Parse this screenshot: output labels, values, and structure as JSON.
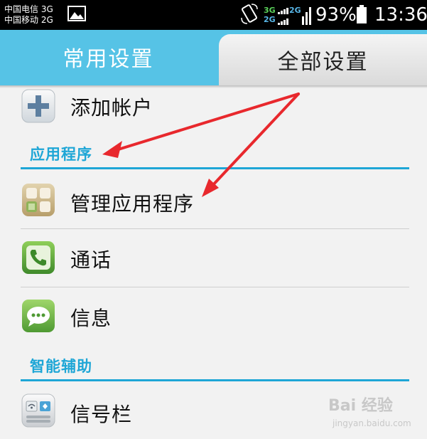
{
  "status_bar": {
    "carrier_1": "中国电信 3G",
    "carrier_2": "中国移动 2G",
    "net_1": "3G",
    "net_2": "2G",
    "net_3": "2G",
    "battery": "93%",
    "time": "13:36",
    "icons": [
      "image-icon",
      "rotate-icon",
      "signal-icon",
      "battery-icon"
    ]
  },
  "tabs": {
    "common": "常用设置",
    "all": "全部设置"
  },
  "settings": {
    "add_account": "添加帐户",
    "section_apps": "应用程序",
    "manage_apps": "管理应用程序",
    "calls": "通话",
    "messages": "信息",
    "section_accessibility": "智能辅助",
    "notification_bar": "信号栏"
  },
  "watermark": {
    "brand": "Bai 经验",
    "sub": "jingyan.baidu.com"
  },
  "colors": {
    "tab_active": "#56c3e6",
    "section_accent": "#1ea6d6",
    "arrow": "#e8282d"
  }
}
